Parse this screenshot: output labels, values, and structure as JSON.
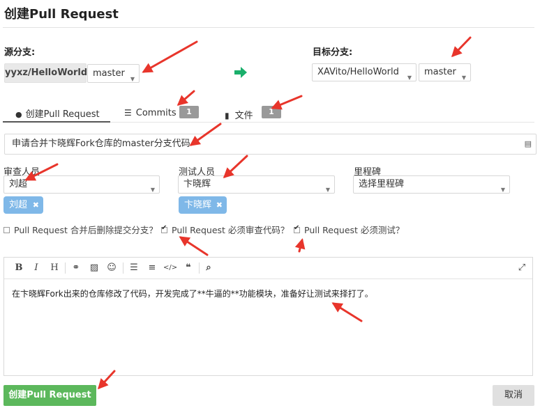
{
  "page": {
    "title": "创建Pull Request"
  },
  "source": {
    "label": "源分支:",
    "repo": "yyxz/HelloWorld",
    "branch": "master"
  },
  "target": {
    "label": "目标分支:",
    "repo": "XAVito/HelloWorld",
    "branch": "master"
  },
  "tabs": [
    {
      "label": "创建Pull Request",
      "icon": "comment-icon"
    },
    {
      "label": "Commits",
      "icon": "list-icon",
      "count": "1"
    },
    {
      "label": "文件",
      "icon": "file-icon",
      "count": "1"
    }
  ],
  "pr_title": {
    "value": "申请合并卞晓辉Fork仓库的master分支代码"
  },
  "reviewers": {
    "label": "审查人员",
    "selected": "刘超",
    "chip": "刘超"
  },
  "testers": {
    "label": "测试人员",
    "selected": "卞晓辉",
    "chip": "卞晓辉"
  },
  "milestone": {
    "label": "里程碑",
    "placeholder": "选择里程碑"
  },
  "options": [
    {
      "label": "Pull Request 合并后删除提交分支？",
      "checked": false
    },
    {
      "label": "Pull Request 必须审查代码？",
      "checked": true
    },
    {
      "label": "Pull Request 必须测试？",
      "checked": true
    }
  ],
  "editor": {
    "toolbar": [
      "bold-icon",
      "italic-icon",
      "heading-icon",
      "link-icon",
      "image-icon",
      "emoji-icon",
      "unordered-list-icon",
      "ordered-list-icon",
      "code-icon",
      "quote-icon",
      "preview-icon",
      "fullscreen-icon"
    ],
    "toolbar_glyphs": {
      "bold": "B",
      "italic": "I",
      "heading": "H",
      "link": "⚭",
      "image": "▨",
      "emoji": "☺",
      "ul": "☰",
      "ol": "≡",
      "code": "</>",
      "quote": "❝",
      "search": "⌕",
      "fullscreen": "⤢"
    },
    "content": "在卞晓辉Fork出来的仓库修改了代码，开发完成了**牛逼的**功能模块，准备好让测试来择打了。"
  },
  "actions": {
    "submit": "创建Pull Request",
    "cancel": "取消"
  },
  "colors": {
    "primary": "#5cb85c",
    "chip": "#7fb8e8",
    "badge": "#999999",
    "arrow": "#e8352b",
    "direction_arrow": "#1aaf6b"
  }
}
